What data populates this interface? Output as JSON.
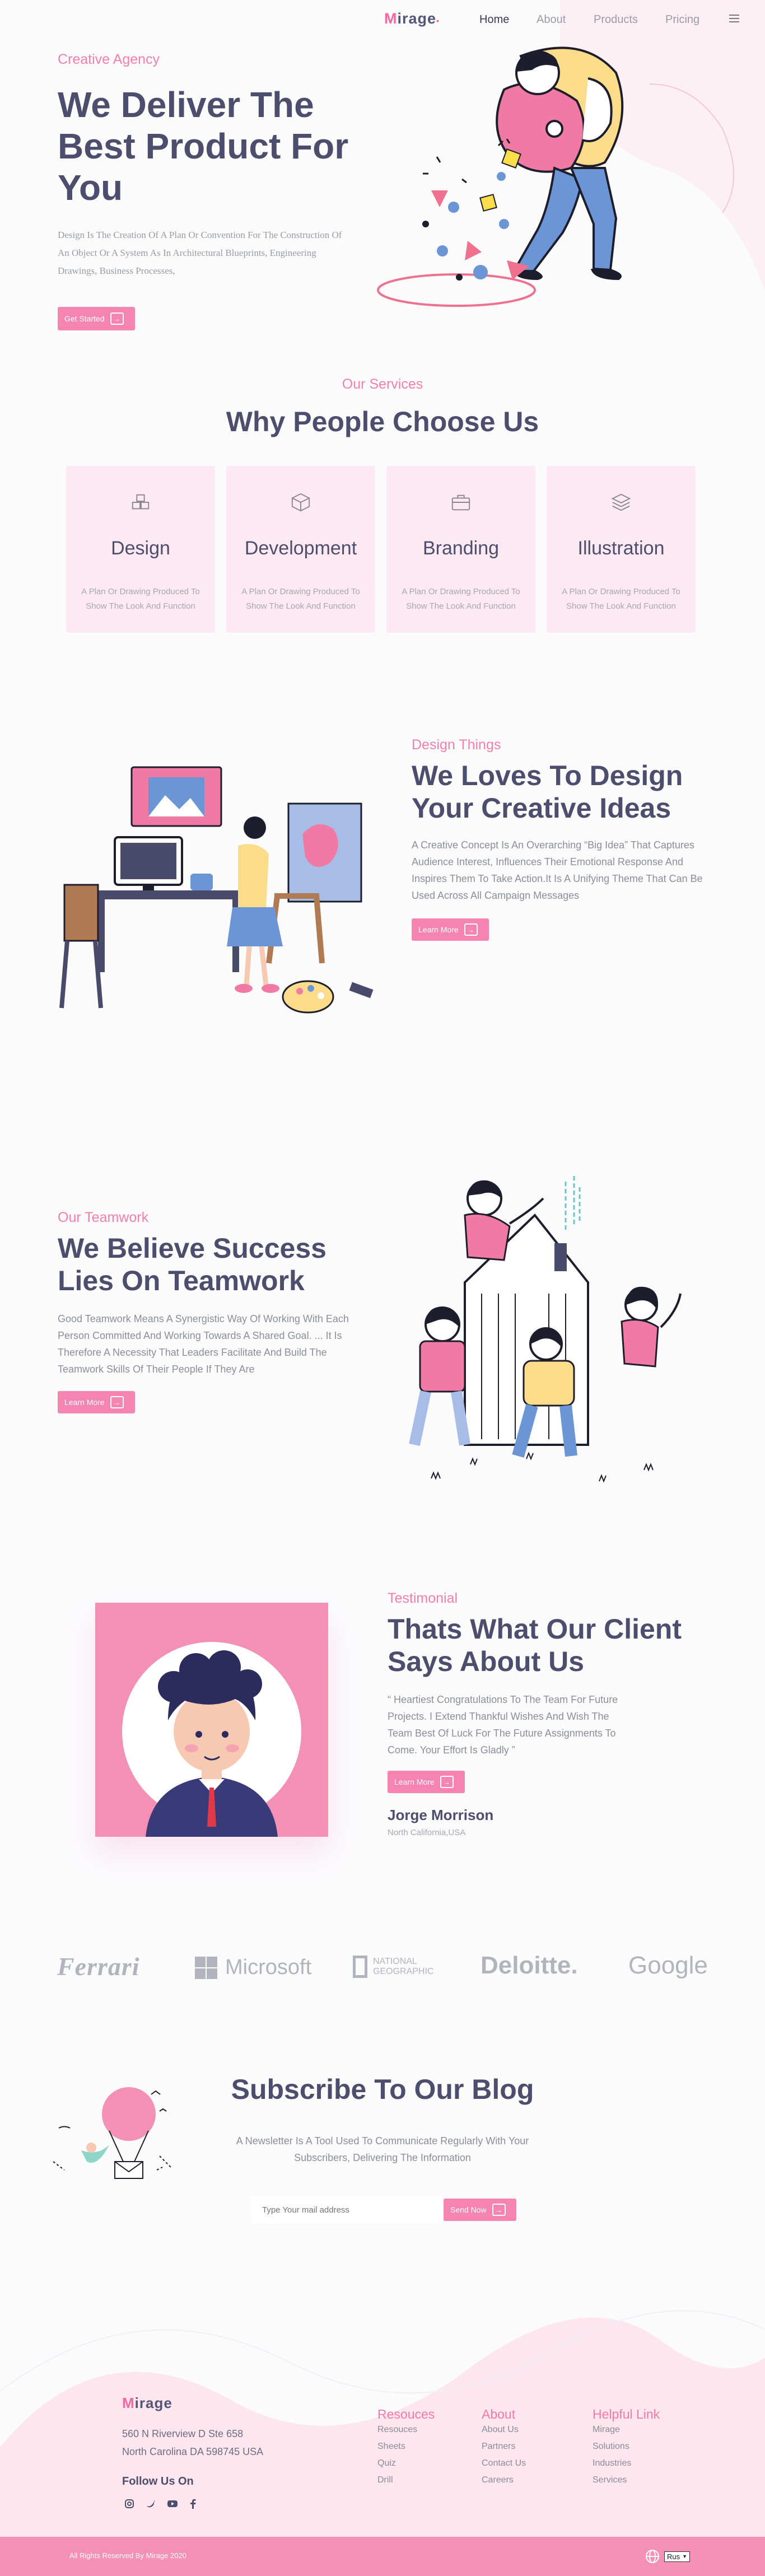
{
  "header": {
    "logo_first": "M",
    "logo_rest": "irage",
    "nav": [
      "Home",
      "About",
      "Products",
      "Pricing"
    ]
  },
  "hero": {
    "eyebrow": "Creative Agency",
    "title": "We Deliver The Best Product For You",
    "text": "Design Is The Creation Of A Plan Or Convention For The Construction Of An Object Or A System As In Architectural Blueprints, Engineering Drawings, Business Processes,",
    "button": "Get Started"
  },
  "services": {
    "eyebrow": "Our Services",
    "title": "Why People Choose Us",
    "cards": [
      {
        "icon": "cubes-icon",
        "title": "Design",
        "text": "A Plan Or Drawing Produced To Show The Look And Function"
      },
      {
        "icon": "box-icon",
        "title": "Development",
        "text": "A Plan Or Drawing Produced To Show The Look And Function"
      },
      {
        "icon": "briefcase-icon",
        "title": "Branding",
        "text": "A Plan Or Drawing Produced To Show The Look And Function"
      },
      {
        "icon": "layers-icon",
        "title": "Illustration",
        "text": "A Plan Or Drawing Produced To Show The Look And Function"
      }
    ]
  },
  "design": {
    "eyebrow": "Design Things",
    "title": "We Loves To Design Your Creative Ideas",
    "text": "A Creative Concept Is An Overarching “Big Idea” That Captures Audience Interest, Influences Their Emotional Response And Inspires Them To Take Action.It Is A Unifying Theme That Can Be Used Across All Campaign Messages",
    "button": "Learn More"
  },
  "team": {
    "eyebrow": "Our Teamwork",
    "title": "We Believe Success Lies On Teamwork",
    "text": "Good Teamwork Means A Synergistic Way Of Working With Each Person Committed And Working Towards A Shared Goal. ... It Is Therefore A Necessity That Leaders Facilitate And Build The Teamwork Skills Of Their People If They Are",
    "button": "Learn More"
  },
  "testimonial": {
    "eyebrow": "Testimonial",
    "title": "Thats What Our Client Says About Us",
    "quote": "“ Heartiest Congratulations To The Team For Future Projects. I Extend Thankful Wishes And Wish The Team Best Of Luck For The Future Assignments To Come. Your Effort Is Gladly ”",
    "button": "Learn More",
    "name": "Jorge Morrison",
    "location": "North California,USA"
  },
  "brands": [
    "Ferrari",
    "Microsoft",
    "NATIONAL GEOGRAPHIC",
    "Deloitte.",
    "Google"
  ],
  "subscribe": {
    "title": "Subscribe To Our Blog",
    "text": "A Newsletter Is A Tool Used To Communicate Regularly With Your Subscribers, Delivering The Information",
    "placeholder": "Type Your mail address",
    "button": "Send Now"
  },
  "footer": {
    "address": "560 N Riverview D Ste 658\nNorth Carolina DA 598745 USA",
    "address_line1": "560 N Riverview D Ste 658",
    "address_line2": "North Carolina DA 598745 USA",
    "follow": "Follow Us On",
    "social": [
      "instagram-icon",
      "twitter-icon",
      "youtube-icon",
      "facebook-icon"
    ],
    "columns": [
      {
        "title": "Resouces",
        "links": [
          "Resouces",
          "Sheets",
          "Quiz",
          "Drill"
        ]
      },
      {
        "title": "About",
        "links": [
          "About Us",
          "Partners",
          "Contact Us",
          "Careers"
        ]
      },
      {
        "title": "Helpful Link",
        "links": [
          "Mirage",
          "Solutions",
          "Industries",
          "Services"
        ]
      }
    ],
    "copyright": "All Rights Reserved By Mirage 2020",
    "language": "Rus"
  },
  "colors": {
    "accent": "#f584b0",
    "text": "#4d4d6d",
    "card_bg": "#fde9f1"
  }
}
